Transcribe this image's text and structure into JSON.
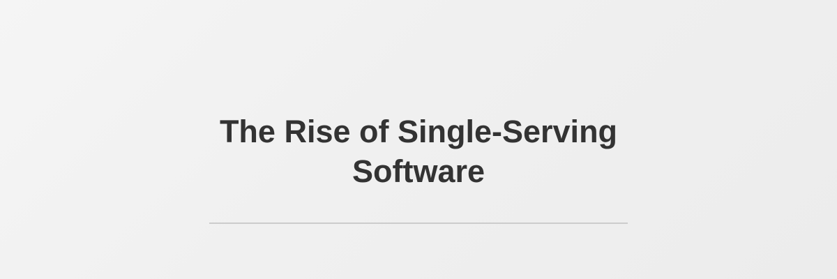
{
  "banner": {
    "title": "The Rise of Single-Serving Software"
  },
  "colors": {
    "background": "#f0f0f0",
    "title": "#333333",
    "divider": "#cccccc"
  }
}
